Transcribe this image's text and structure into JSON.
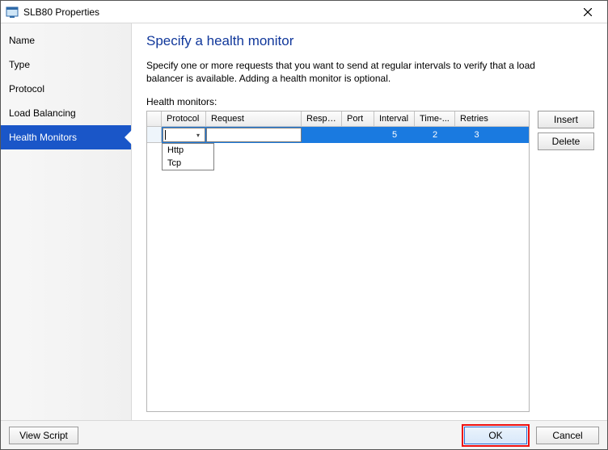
{
  "window": {
    "title": "SLB80 Properties"
  },
  "sidebar": {
    "items": [
      {
        "label": "Name"
      },
      {
        "label": "Type"
      },
      {
        "label": "Protocol"
      },
      {
        "label": "Load Balancing"
      },
      {
        "label": "Health Monitors",
        "active": true
      }
    ]
  },
  "page": {
    "heading": "Specify a health monitor",
    "description": "Specify one or more requests that you want to send at regular intervals to verify that a load balancer is available. Adding a health monitor is optional.",
    "list_label": "Health monitors:"
  },
  "grid": {
    "columns": {
      "protocol": "Protocol",
      "request": "Request",
      "response": "Respo...",
      "port": "Port",
      "interval": "Interval",
      "timeout": "Time-...",
      "retries": "Retries"
    },
    "row": {
      "protocol": "",
      "request": "",
      "response": "",
      "port": "",
      "interval": "5",
      "timeout": "2",
      "retries": "3"
    },
    "protocol_options": [
      "Http",
      "Tcp"
    ]
  },
  "buttons": {
    "insert": "Insert",
    "delete": "Delete",
    "view_script": "View Script",
    "ok": "OK",
    "cancel": "Cancel"
  }
}
